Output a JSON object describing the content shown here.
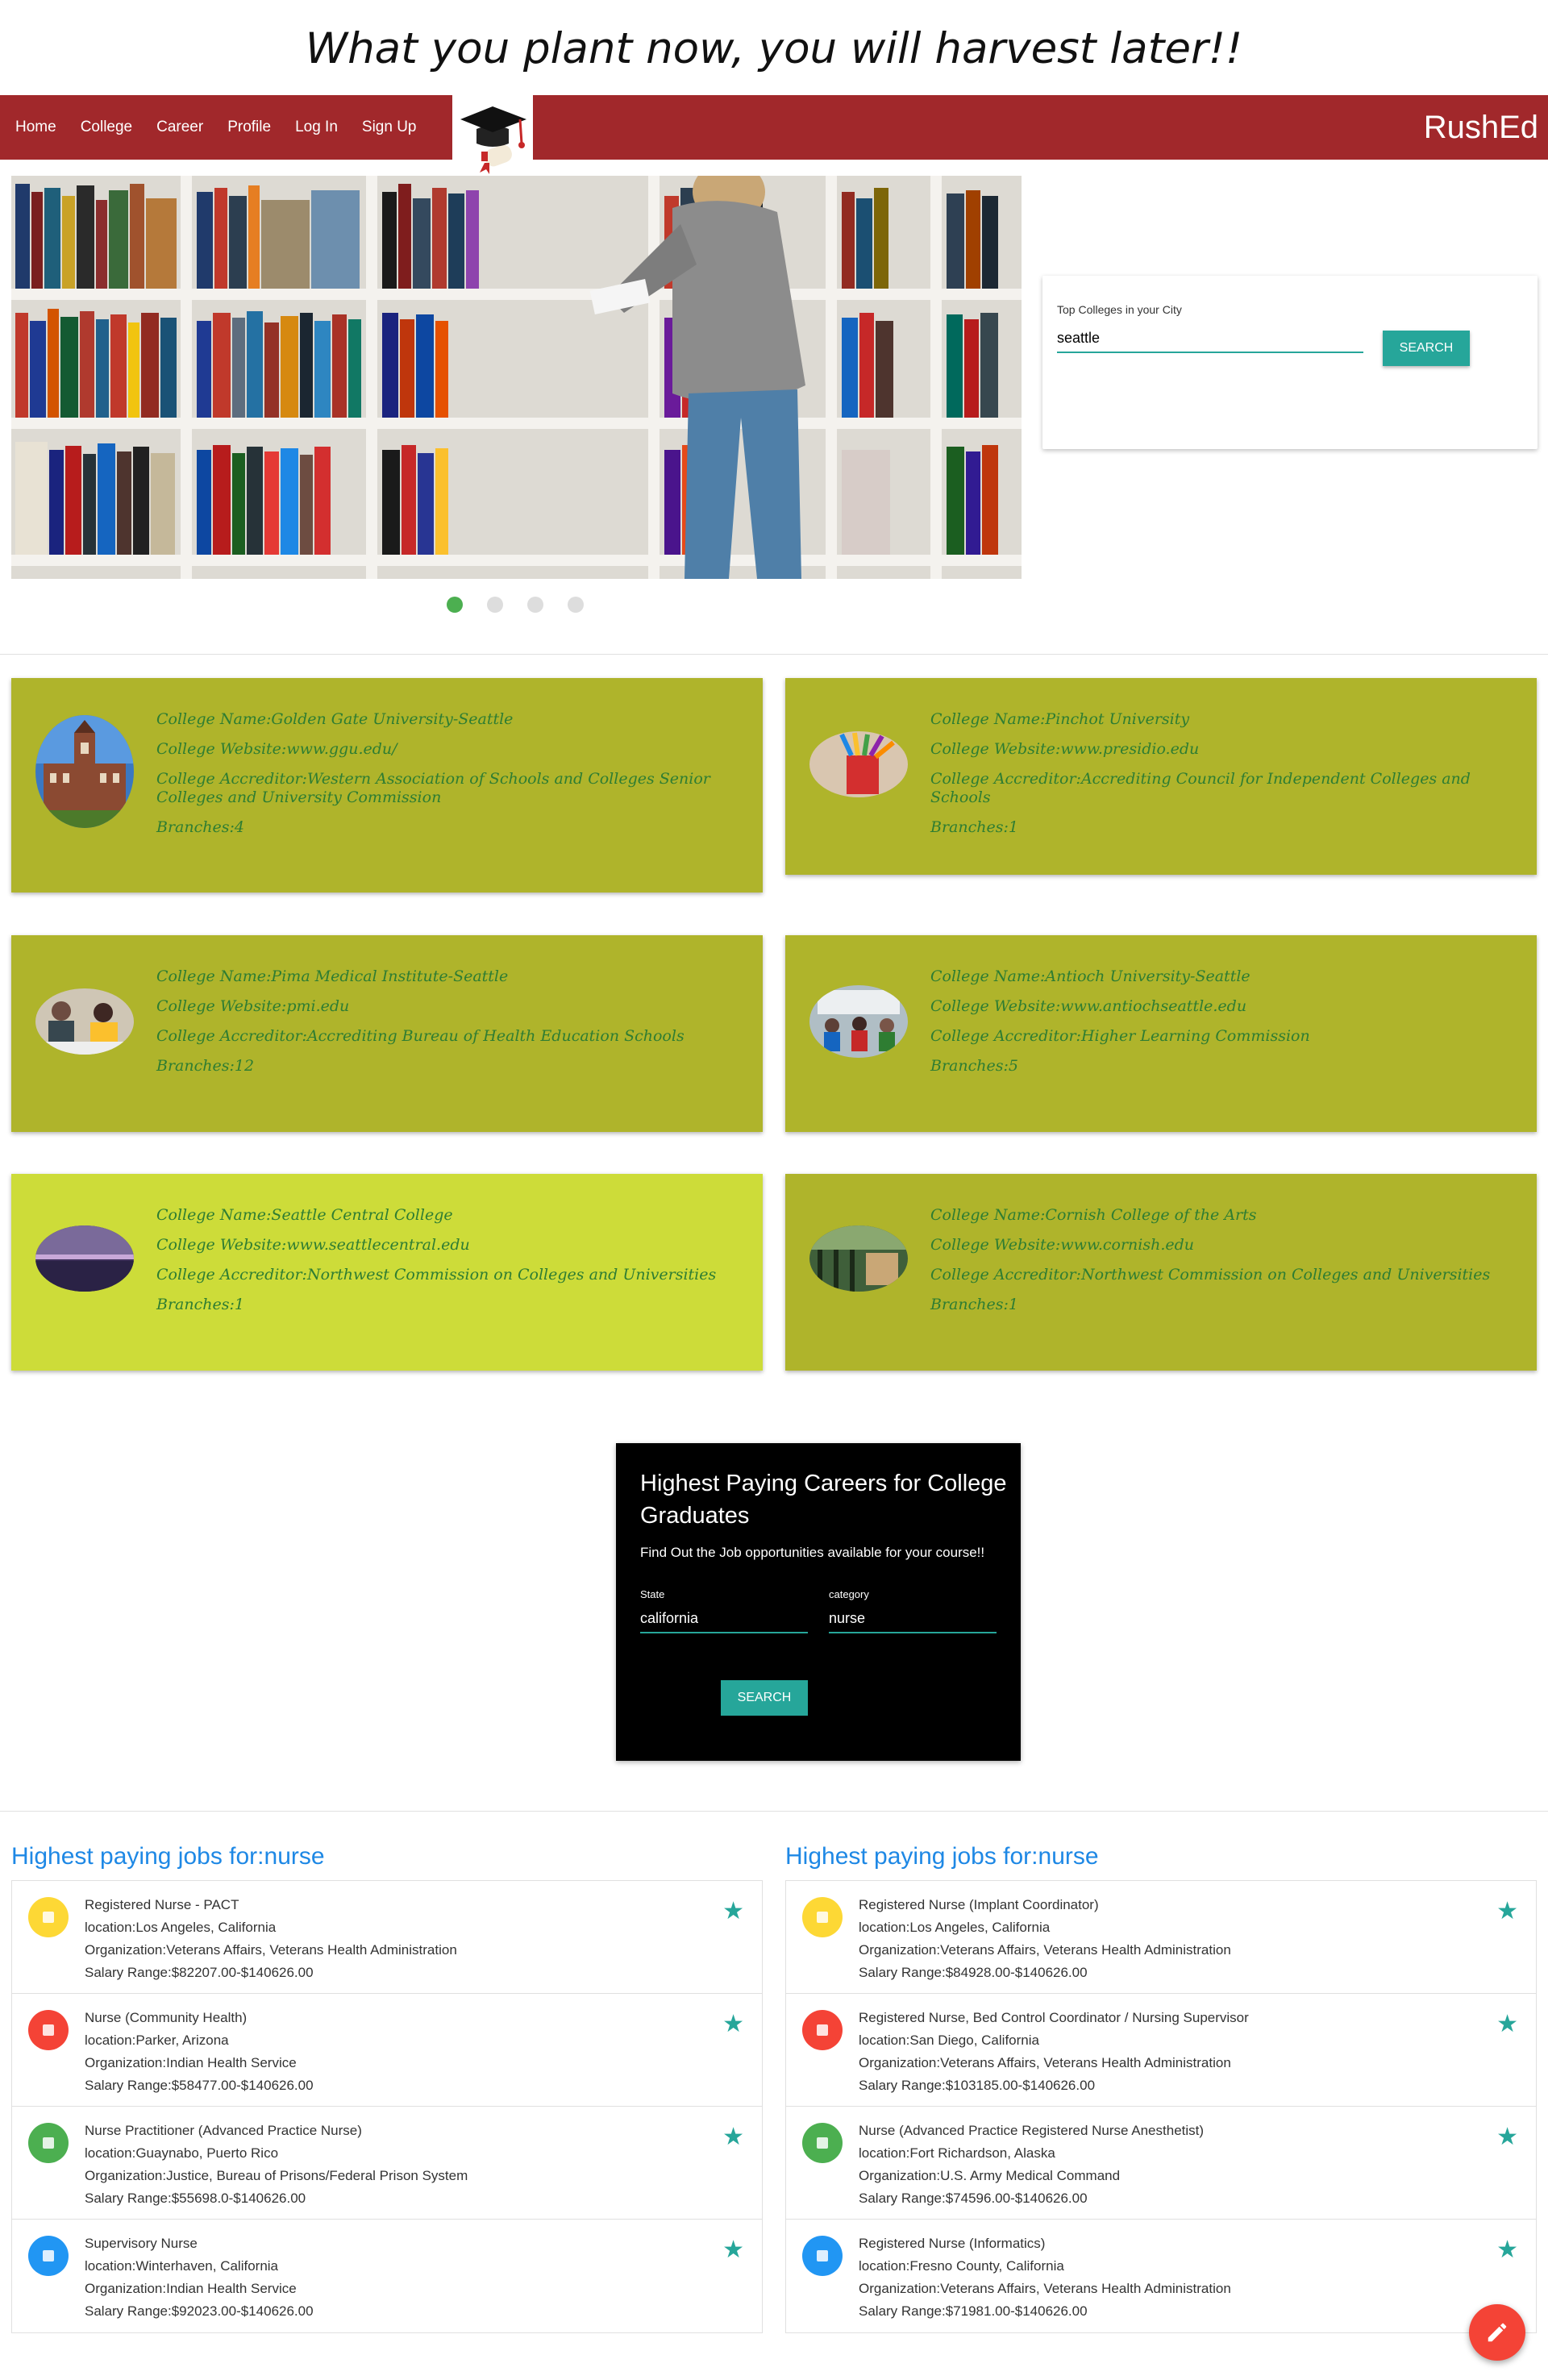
{
  "motto": "What you plant now, you will harvest later!!",
  "nav": {
    "links": [
      "Home",
      "College",
      "Career",
      "Profile",
      "Log In",
      "Sign Up"
    ],
    "brand": "RushEd"
  },
  "carousel": {
    "total_slides": 4,
    "active_slide": 1
  },
  "college_search": {
    "label": "Top Colleges in your City",
    "value": "seattle",
    "button": "SEARCH"
  },
  "colleges": [
    {
      "name": "College Name:Golden Gate University-Seattle",
      "website": "College Website:www.ggu.edu/",
      "accreditor": "College Accreditor:Western Association of Schools and Colleges Senior Colleges and University Commission",
      "branches": "Branches:4",
      "thumb": "university-building-icon"
    },
    {
      "name": "College Name:Pinchot University",
      "website": "College Website:www.presidio.edu",
      "accreditor": "College Accreditor:Accrediting Council for Independent Colleges and Schools",
      "branches": "Branches:1",
      "thumb": "pencils-icon"
    },
    {
      "name": "College Name:Pima Medical Institute-Seattle",
      "website": "College Website:pmi.edu",
      "accreditor": "College Accreditor:Accrediting Bureau of Health Education Schools",
      "branches": "Branches:12",
      "thumb": "students-icon"
    },
    {
      "name": "College Name:Antioch University-Seattle",
      "website": "College Website:www.antiochseattle.edu",
      "accreditor": "College Accreditor:Higher Learning Commission",
      "branches": "Branches:5",
      "thumb": "classroom-icon"
    },
    {
      "name": "College Name:Seattle Central College",
      "website": "College Website:www.seattlecentral.edu",
      "accreditor": "College Accreditor:Northwest Commission on Colleges and Universities",
      "branches": "Branches:1",
      "thumb": "pier-icon"
    },
    {
      "name": "College Name:Cornish College of the Arts",
      "website": "College Website:www.cornish.edu",
      "accreditor": "College Accreditor:Northwest Commission on Colleges and Universities",
      "branches": "Branches:1",
      "thumb": "library-icon"
    }
  ],
  "careers": {
    "title": "Highest Paying Careers for College Graduates",
    "subtitle": "Find Out the Job opportunities available for your course!!",
    "state_label": "State",
    "state_value": "california",
    "category_label": "category",
    "category_value": "nurse",
    "button": "SEARCH"
  },
  "jobs_left": {
    "title": "Highest paying jobs for:nurse",
    "items": [
      {
        "title": "Registered Nurse - PACT",
        "location": "location:Los Angeles, California",
        "org": "Organization:Veterans Affairs, Veterans Health Administration",
        "salary": "Salary Range:$82207.00-$140626.00",
        "color": "#fdd835"
      },
      {
        "title": "Nurse (Community Health)",
        "location": "location:Parker, Arizona",
        "org": "Organization:Indian Health Service",
        "salary": "Salary Range:$58477.00-$140626.00",
        "color": "#f44336"
      },
      {
        "title": "Nurse Practitioner (Advanced Practice Nurse)",
        "location": "location:Guaynabo, Puerto Rico",
        "org": "Organization:Justice, Bureau of Prisons/Federal Prison System",
        "salary": "Salary Range:$55698.0-$140626.00",
        "color": "#4caf50"
      },
      {
        "title": "Supervisory Nurse",
        "location": "location:Winterhaven, California",
        "org": "Organization:Indian Health Service",
        "salary": "Salary Range:$92023.00-$140626.00",
        "color": "#2196f3"
      }
    ]
  },
  "jobs_right": {
    "title": "Highest paying jobs for:nurse",
    "items": [
      {
        "title": "Registered Nurse (Implant Coordinator)",
        "location": "location:Los Angeles, California",
        "org": "Organization:Veterans Affairs, Veterans Health Administration",
        "salary": "Salary Range:$84928.00-$140626.00",
        "color": "#fdd835"
      },
      {
        "title": "Registered Nurse, Bed Control Coordinator / Nursing Supervisor",
        "location": "location:San Diego, California",
        "org": "Organization:Veterans Affairs, Veterans Health Administration",
        "salary": "Salary Range:$103185.00-$140626.00",
        "color": "#f44336"
      },
      {
        "title": "Nurse (Advanced Practice Registered Nurse Anesthetist)",
        "location": "location:Fort Richardson, Alaska",
        "org": "Organization:U.S. Army Medical Command",
        "salary": "Salary Range:$74596.00-$140626.00",
        "color": "#4caf50"
      },
      {
        "title": "Registered Nurse (Informatics)",
        "location": "location:Fresno County, California",
        "org": "Organization:Veterans Affairs, Veterans Health Administration",
        "salary": "Salary Range:$71981.00-$140626.00",
        "color": "#2196f3"
      }
    ]
  },
  "icons": {
    "star": "star-icon",
    "fab": "pencil-icon",
    "logo": "graduation-cap-icon"
  }
}
